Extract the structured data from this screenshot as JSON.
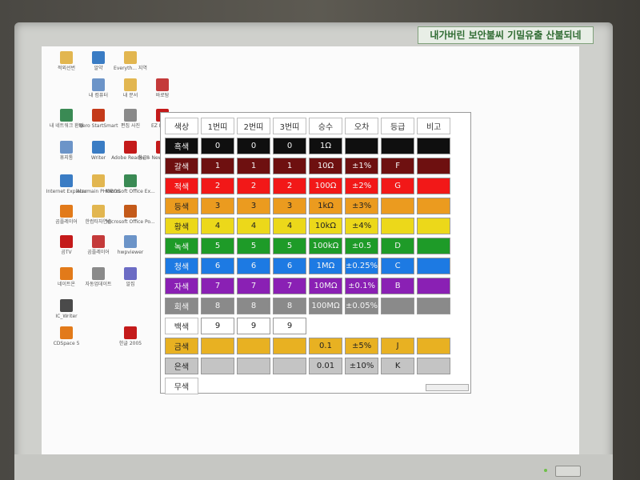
{
  "sticker_text": "내가버린 보안불씨 기밀유출 산불되네",
  "colors": {
    "black": "#0f0f0f",
    "brown": "#6e1010",
    "red": "#f21818",
    "orange": "#eb9b1f",
    "yellow": "#ecd81a",
    "green": "#1e9b28",
    "blue": "#1d7ae3",
    "violet": "#8a20b4",
    "gray": "#8a8a8a",
    "white": "#ffffff",
    "gold": "#e8b122",
    "silver": "#c4c4c4"
  },
  "desktop_icons": [
    {
      "label": "적외선번",
      "color": "#e2b650"
    },
    {
      "label": "알약",
      "color": "#3a7cc4"
    },
    {
      "label": "Everyth... 지역",
      "color": "#e2b650"
    },
    {
      "label": "내 컴퓨터",
      "color": "#6c94c8"
    },
    {
      "label": "내 문서",
      "color": "#e2b650"
    },
    {
      "label": "바로탐",
      "color": "#c43a3a"
    },
    {
      "label": "내 네트워크 환경",
      "color": "#3a8a54"
    },
    {
      "label": "Nero StartSmart",
      "color": "#c43a1a"
    },
    {
      "label": "편집 사진",
      "color": "#8a8a8a"
    },
    {
      "label": "EZ Power",
      "color": "#c41a1a"
    },
    {
      "label": "휴지통",
      "color": "#6c94c8"
    },
    {
      "label": "Writer",
      "color": "#3a7cc4"
    },
    {
      "label": "Adobe Reader 8",
      "color": "#c41a1a"
    },
    {
      "label": "한글 - New your time",
      "color": "#c41a1a"
    },
    {
      "label": "Internet Explorer",
      "color": "#3a7cc4"
    },
    {
      "label": "Alzumain PHOBOS",
      "color": "#e2b650"
    },
    {
      "label": "Microsoft Office Ex...",
      "color": "#3a8a54"
    },
    {
      "label": "곰플레이어",
      "color": "#e27a1a"
    },
    {
      "label": "한컴타자연습",
      "color": "#e2b650"
    },
    {
      "label": "Microsoft Office Po...",
      "color": "#c45a1a"
    },
    {
      "label": "곰TV",
      "color": "#c41a1a"
    },
    {
      "label": "곰플레이어",
      "color": "#c43a3a"
    },
    {
      "label": "hwpviewer",
      "color": "#6c94c8"
    },
    {
      "label": "네이트온",
      "color": "#e27a1a"
    },
    {
      "label": "자동업데이트",
      "color": "#8a8a8a"
    },
    {
      "label": "알집",
      "color": "#6c6cc4"
    },
    {
      "label": "IC_Writer",
      "color": "#4a4a4a"
    },
    {
      "label": "CDSpace 5",
      "color": "#e27a1a"
    },
    {
      "label": "한글 2005",
      "color": "#c41a1a"
    }
  ],
  "headers": [
    "색상",
    "1번띠",
    "2번띠",
    "3번띠",
    "승수",
    "오차",
    "등급",
    "비고"
  ],
  "rows": [
    {
      "name": "흑색",
      "key": "black",
      "band1": "0",
      "band2": "0",
      "band3": "0",
      "mult": "1Ω",
      "tol": "",
      "grade": ""
    },
    {
      "name": "갈색",
      "key": "brown",
      "band1": "1",
      "band2": "1",
      "band3": "1",
      "mult": "10Ω",
      "tol": "±1%",
      "grade": "F"
    },
    {
      "name": "적색",
      "key": "red",
      "band1": "2",
      "band2": "2",
      "band3": "2",
      "mult": "100Ω",
      "tol": "±2%",
      "grade": "G"
    },
    {
      "name": "등색",
      "key": "orange",
      "band1": "3",
      "band2": "3",
      "band3": "3",
      "mult": "1kΩ",
      "tol": "±3%",
      "grade": ""
    },
    {
      "name": "황색",
      "key": "yellow",
      "band1": "4",
      "band2": "4",
      "band3": "4",
      "mult": "10kΩ",
      "tol": "±4%",
      "grade": ""
    },
    {
      "name": "녹색",
      "key": "green",
      "band1": "5",
      "band2": "5",
      "band3": "5",
      "mult": "100kΩ",
      "tol": "±0.5",
      "grade": "D"
    },
    {
      "name": "청색",
      "key": "blue",
      "band1": "6",
      "band2": "6",
      "band3": "6",
      "mult": "1MΩ",
      "tol": "±0.25%",
      "grade": "C"
    },
    {
      "name": "자색",
      "key": "violet",
      "band1": "7",
      "band2": "7",
      "band3": "7",
      "mult": "10MΩ",
      "tol": "±0.1%",
      "grade": "B"
    },
    {
      "name": "회색",
      "key": "gray",
      "band1": "8",
      "band2": "8",
      "band3": "8",
      "mult": "100MΩ",
      "tol": "±0.05%",
      "grade": ""
    },
    {
      "name": "백색",
      "key": "white",
      "band1": "9",
      "band2": "9",
      "band3": "9",
      "mult": "",
      "tol": "",
      "grade": ""
    },
    {
      "name": "금색",
      "key": "gold",
      "band1": "",
      "band2": "",
      "band3": "",
      "mult": "0.1",
      "tol": "±5%",
      "grade": "J"
    },
    {
      "name": "은색",
      "key": "silver",
      "band1": "",
      "band2": "",
      "band3": "",
      "mult": "0.01",
      "tol": "±10%",
      "grade": "K"
    },
    {
      "name": "무색",
      "key": "none",
      "band1": "",
      "band2": "",
      "band3": "",
      "mult": "",
      "tol": "",
      "grade": ""
    }
  ]
}
